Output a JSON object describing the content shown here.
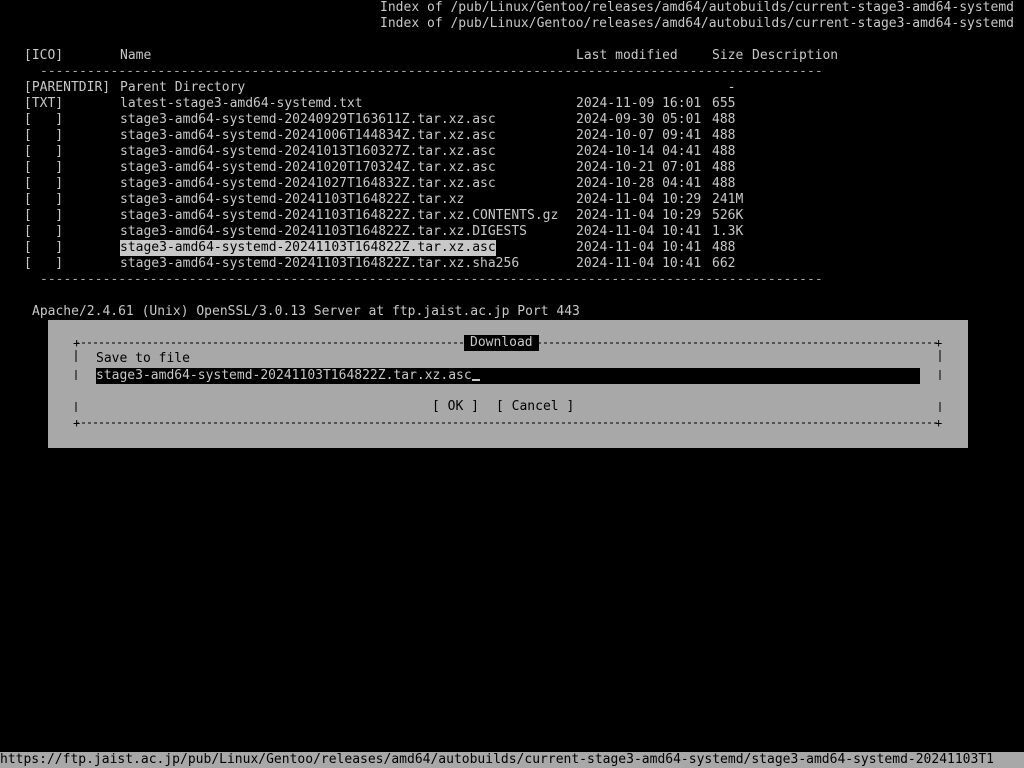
{
  "page": {
    "title_1": "Index of /pub/Linux/Gentoo/releases/amd64/autobuilds/current-stage3-amd64-systemd",
    "title_2": "Index of /pub/Linux/Gentoo/releases/amd64/autobuilds/current-stage3-amd64-systemd"
  },
  "table": {
    "headers": {
      "ico": "[ICO]",
      "name": "Name",
      "modified": "Last modified",
      "size": "Size",
      "description": "Description"
    },
    "rule": "-------------------------------------------------------------------------------------------------------",
    "rows": [
      {
        "ico": "[PARENTDIR]",
        "name": "Parent Directory",
        "modified": "",
        "size": "  -"
      },
      {
        "ico": "[TXT]",
        "name": "latest-stage3-amd64-systemd.txt",
        "modified": "2024-11-09 16:01",
        "size": "655"
      },
      {
        "ico": "[   ]",
        "name": "stage3-amd64-systemd-20240929T163611Z.tar.xz.asc",
        "modified": "2024-09-30 05:01",
        "size": "488"
      },
      {
        "ico": "[   ]",
        "name": "stage3-amd64-systemd-20241006T144834Z.tar.xz.asc",
        "modified": "2024-10-07 09:41",
        "size": "488"
      },
      {
        "ico": "[   ]",
        "name": "stage3-amd64-systemd-20241013T160327Z.tar.xz.asc",
        "modified": "2024-10-14 04:41",
        "size": "488"
      },
      {
        "ico": "[   ]",
        "name": "stage3-amd64-systemd-20241020T170324Z.tar.xz.asc",
        "modified": "2024-10-21 07:01",
        "size": "488"
      },
      {
        "ico": "[   ]",
        "name": "stage3-amd64-systemd-20241027T164832Z.tar.xz.asc",
        "modified": "2024-10-28 04:41",
        "size": "488"
      },
      {
        "ico": "[   ]",
        "name": "stage3-amd64-systemd-20241103T164822Z.tar.xz",
        "modified": "2024-11-04 10:29",
        "size": "241M"
      },
      {
        "ico": "[   ]",
        "name": "stage3-amd64-systemd-20241103T164822Z.tar.xz.CONTENTS.gz",
        "modified": "2024-11-04 10:29",
        "size": "526K"
      },
      {
        "ico": "[   ]",
        "name": "stage3-amd64-systemd-20241103T164822Z.tar.xz.DIGESTS",
        "modified": "2024-11-04 10:41",
        "size": "1.3K"
      },
      {
        "ico": "[   ]",
        "name": "stage3-amd64-systemd-20241103T164822Z.tar.xz.asc",
        "modified": "2024-11-04 10:41",
        "size": "488",
        "selected": true
      },
      {
        "ico": "[   ]",
        "name": "stage3-amd64-systemd-20241103T164822Z.tar.xz.sha256",
        "modified": "2024-11-04 10:41",
        "size": "662"
      }
    ]
  },
  "server_signature": "Apache/2.4.61 (Unix) OpenSSL/3.0.13 Server at ftp.jaist.ac.jp Port 443",
  "dialog": {
    "title": "Download",
    "prompt": "Save to file",
    "filename": "stage3-amd64-systemd-20241103T164822Z.tar.xz.asc",
    "ok_label": "[ OK ]",
    "cancel_label": "[ Cancel ]"
  },
  "status_bar": {
    "url": "https://ftp.jaist.ac.jp/pub/Linux/Gentoo/releases/amd64/autobuilds/current-stage3-amd64-systemd/stage3-amd64-systemd-20241103T1"
  },
  "colors": {
    "background": "#000000",
    "text": "#c8c8c8",
    "dialog_bg": "#a8a8a8"
  }
}
